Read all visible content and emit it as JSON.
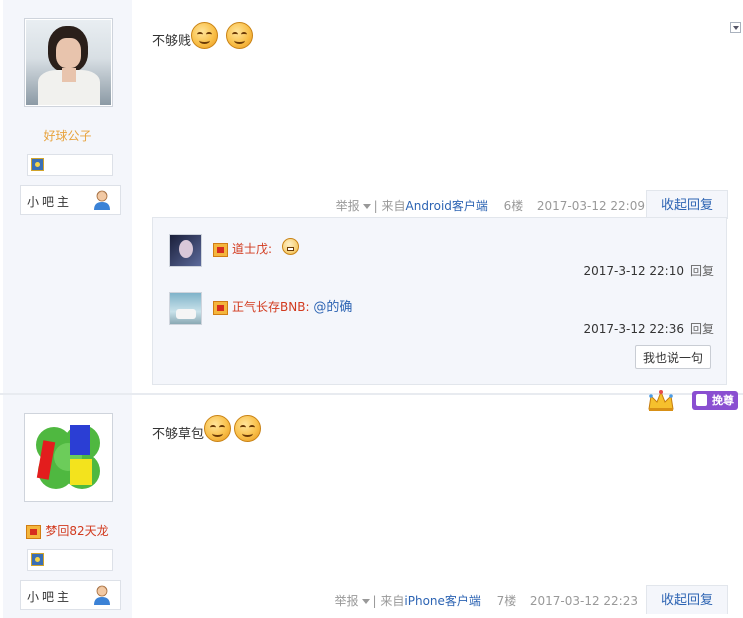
{
  "posts": [
    {
      "username": "好球公子",
      "role": "小吧主",
      "content": "不够贱",
      "report": "举报",
      "source_prefix": "| 来自",
      "source": "Android客户端",
      "floor": "6楼",
      "time": "2017-03-12 22:09",
      "reply_toggle": "收起回复",
      "comments": [
        {
          "name": "道士戊:",
          "text": "",
          "time": "2017-3-12 22:10",
          "reply": "回复"
        },
        {
          "name": "正气长存BNB:",
          "text": "@的确",
          "time": "2017-3-12 22:36",
          "reply": "回复"
        }
      ],
      "say_button": "我也说一句"
    },
    {
      "username": "梦回82天龙",
      "role": "小吧主",
      "content": "不够草包",
      "report": "举报",
      "source_prefix": "| 来自",
      "source": "iPhone客户端",
      "floor": "7楼",
      "time": "2017-03-12 22:23",
      "reply_toggle": "收起回复"
    }
  ],
  "crown_badge": "挽尊",
  "colors": {
    "link": "#2d64b3",
    "username_orange": "#e8a33d",
    "username_red": "#d23a1e",
    "badge_purple": "#8a4fd1"
  }
}
